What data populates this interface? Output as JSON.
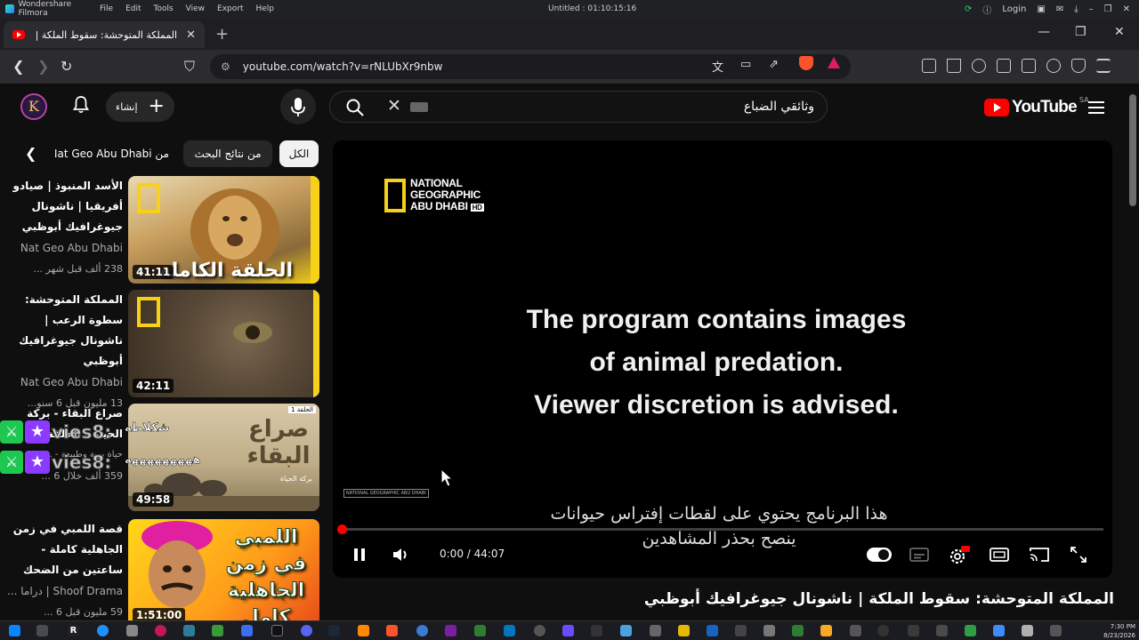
{
  "filmora": {
    "app_name": "Wondershare Filmora",
    "menu": [
      "File",
      "Edit",
      "Tools",
      "View",
      "Export",
      "Help"
    ],
    "title": "Untitled : 01:10:15:16",
    "login": "Login"
  },
  "browser": {
    "tab_title": "المملكة المتوحشة: سقوط الملكة |",
    "url": "youtube.com/watch?v=rNLUbXr9nbw"
  },
  "youtube": {
    "create_label": "إنشاء",
    "search_query": "وثائقي الضباع",
    "logo_text": "YouTube",
    "country_code": "SA",
    "avatar_letter": "K",
    "chips": [
      {
        "label": "الكل"
      },
      {
        "label": "من نتائج البحث"
      },
      {
        "label": "من Nat Geo Abu Dhabi"
      }
    ],
    "related": [
      {
        "title": "الأسد المنبوذ | صيادو أفريقيا | ناشونال جيوغرافيك أبوظبي",
        "channel": "Nat Geo Abu Dhabi",
        "meta": "238 ألف  قبل شهر ...",
        "duration": "41:11",
        "thumb_text": "الحلقة الكاملة"
      },
      {
        "title": "المملكة المتوحشة: سطوة الرعب | ناشونال جيوغرافيك أبوظبي",
        "channel": "Nat Geo Abu Dhabi",
        "meta": "13 مليون  قبل 6 سنو...",
        "duration": "42:11",
        "thumb_text": ""
      },
      {
        "title": "صراع البقاء - بركة الحياة - الحلقة 1",
        "channel": "حياة برية وطبيعة - ...ery",
        "meta": "359 ألف  خلال 6 ...",
        "duration": "49:58",
        "thumb_text": "صراع البقاء",
        "thumb_tag": "الحلقة 1",
        "thumb_sub": "بركة الحياة"
      },
      {
        "title": "قصة اللمبي في زمن الجاهلية كاملة - ساعتين من الضحك",
        "channel": "Shoof Drama | دراما ...",
        "meta": "59 مليون  قبل 6 ...",
        "duration": "1:51:00",
        "thumb_text": "اللمبي في زمن الجاهلية كامل"
      }
    ],
    "overlay": [
      {
        "name": "vies8:",
        "comment": "شكلاطه"
      },
      {
        "name": "vies8:",
        "comment": "هههههههههه"
      }
    ],
    "player": {
      "brand_line1": "NATIONAL",
      "brand_line2": "GEOGRAPHIC",
      "brand_line3": "ABU DHABI",
      "brand_hd": "HD",
      "small_brand": "NATIONAL GEOGRAPHIC ABU DHABI",
      "warning_lines": [
        "The program contains images",
        "of animal predation.",
        "Viewer discretion is advised."
      ],
      "subtitle_line1": "هذا البرنامج يحتوي على لقطات إفتراس حيوانات",
      "subtitle_line2": "ينصح بحذر المشاهدين",
      "time": "0:00 / 44:07",
      "progress_fraction": 0.0,
      "hd_badge": "HD"
    },
    "video_title": "المملكة المتوحشة: سقوط الملكة | ناشونال جيوغرافيك أبوظبي"
  },
  "taskbar": {
    "date": "8/23/2026",
    "time": "7:30 PM"
  },
  "colors": {
    "accent_red": "#ff0000",
    "natgeo_yellow": "#f7d117",
    "background": "#0f0f0f"
  }
}
